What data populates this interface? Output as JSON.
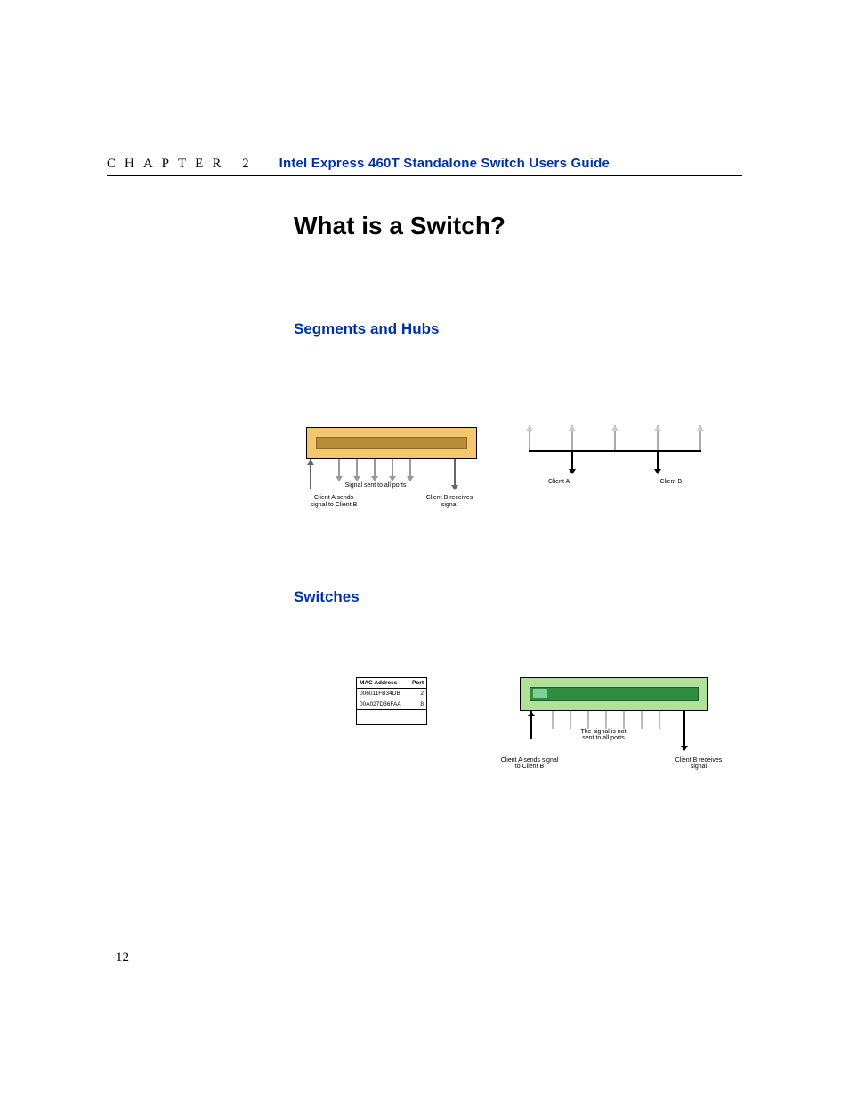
{
  "header": {
    "chapter_label": "CHAPTER 2",
    "guide_title": "Intel Express 460T Standalone Switch Users Guide"
  },
  "main_heading": "What is a Switch?",
  "sections": {
    "segments": {
      "heading": "Segments and Hubs"
    },
    "switches": {
      "heading": "Switches"
    }
  },
  "fig_hub": {
    "caption_mid": "Signal sent to all ports",
    "caption_left": "Client A sends signal to Client B",
    "caption_right": "Client B receives signal"
  },
  "fig_bus": {
    "label_left": "Client A",
    "label_right": "Client B"
  },
  "mac_table": {
    "headers": {
      "mac": "MAC Address",
      "port": "Port"
    },
    "rows": [
      {
        "mac": "006011FB34DB",
        "port": "2"
      },
      {
        "mac": "00A027D36FAA",
        "port": "8"
      }
    ]
  },
  "fig_switch": {
    "caption_mid_l1": "The signal is not",
    "caption_mid_l2": "sent to all ports",
    "caption_left": "Client A sends signal to Client B",
    "caption_right": "Client B receives signal"
  },
  "page_number": "12"
}
